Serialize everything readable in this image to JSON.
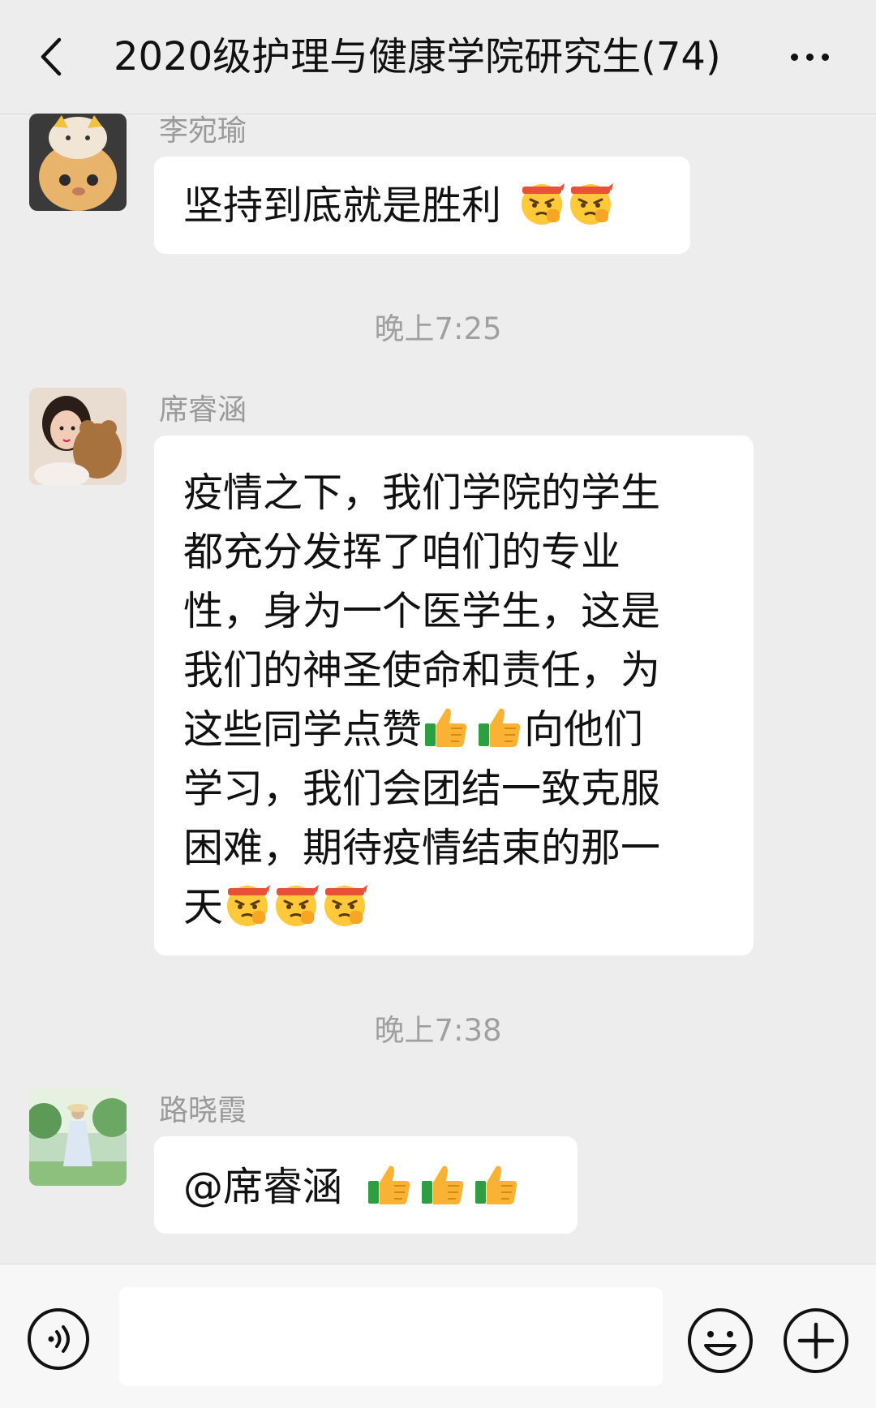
{
  "header": {
    "title": "2020级护理与健康学院研究生(74)"
  },
  "messages": [
    {
      "sender": "李宛瑜",
      "text": "坚持到底就是胜利",
      "emojis": [
        "determined-emoji",
        "determined-emoji"
      ]
    },
    {
      "timestamp": "晚上7:25"
    },
    {
      "sender": "席睿涵",
      "lines": [
        "疫情之下，我们学院的学生",
        "都充分发挥了咱们的专业",
        "性，身为一个医学生，这是",
        "我们的神圣使命和责任，为",
        "这些同学点赞",
        "向他们",
        "学习，我们会团结一致克服",
        "困难，期待疫情结束的那一",
        "天"
      ],
      "emojis_inline": [
        "thumbs-up-emoji",
        "thumbs-up-emoji"
      ],
      "emojis_end": [
        "determined-emoji",
        "determined-emoji",
        "determined-emoji"
      ]
    },
    {
      "timestamp": "晚上7:38"
    },
    {
      "sender": "路晓霞",
      "text": "@席睿涵",
      "emojis": [
        "thumbs-up-emoji",
        "thumbs-up-emoji",
        "thumbs-up-emoji"
      ]
    }
  ],
  "icons": {
    "back": "chevron-left-icon",
    "more": "more-dots-icon",
    "voice": "voice-icon",
    "emoji": "smiley-icon",
    "plus": "plus-circle-icon"
  },
  "input": {
    "value": ""
  }
}
